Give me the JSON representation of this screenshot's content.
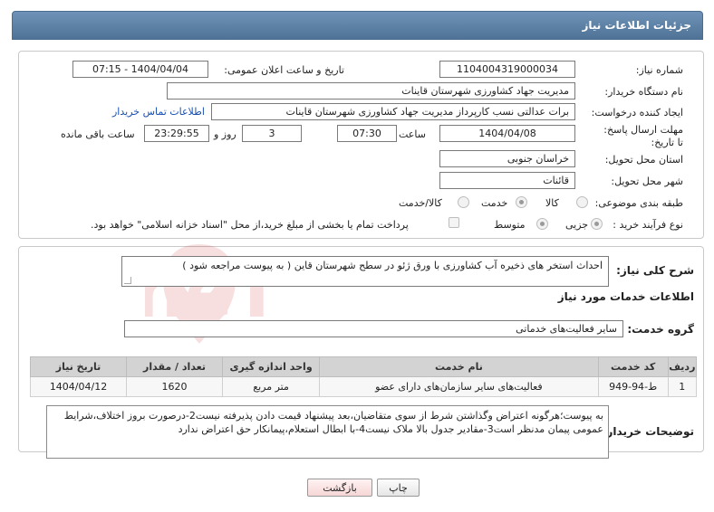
{
  "header": {
    "title": "جزئیات اطلاعات نیاز"
  },
  "form": {
    "need_number": {
      "label": "شماره نیاز:",
      "value": "1104004319000034"
    },
    "announce_datetime": {
      "label": "تاریخ و ساعت اعلان عمومی:",
      "value": "1404/04/04 - 07:15"
    },
    "buyer_org": {
      "label": "نام دستگاه خریدار:",
      "value": "مدیریت جهاد کشاورزی شهرستان قاینات"
    },
    "requester": {
      "label": "ایجاد کننده درخواست:",
      "value": "برات عدالتی نسب کارپرداز مدیریت جهاد کشاورزی شهرستان قاینات",
      "contact_link": "اطلاعات تماس خریدار"
    },
    "deadline": {
      "label": "مهلت ارسال پاسخ: تا تاریخ:",
      "date": "1404/04/08",
      "time_label": "ساعت",
      "time": "07:30",
      "days": "3",
      "days_label": "روز و",
      "remaining": "23:29:55",
      "remaining_label": "ساعت باقی مانده"
    },
    "province": {
      "label": "استان محل تحویل:",
      "value": "خراسان جنوبی"
    },
    "city": {
      "label": "شهر محل تحویل:",
      "value": "قائنات"
    },
    "category": {
      "label": "طبقه بندی موضوعی:",
      "options": [
        "کالا",
        "خدمت",
        "کالا/خدمت"
      ],
      "selected": "خدمت"
    },
    "purchase_type": {
      "label": "نوع فرآیند خرید :",
      "options": [
        "جزیی",
        "متوسط"
      ],
      "selected": "جزیی",
      "treasury_note": "پرداخت تمام یا بخشی از مبلغ خرید،از محل \"اسناد خزانه اسلامی\" خواهد بود."
    }
  },
  "need_summary": {
    "label": "شرح کلی نیاز:",
    "value": "احداث استخر های ذخیره آب کشاورزی با ورق ژئو در سطح شهرستان قاین ( به پیوست مراجعه شود )"
  },
  "services": {
    "section_title": "اطلاعات خدمات مورد نیاز",
    "group_label": "گروه خدمت:",
    "group_value": "سایر فعالیت‌های خدماتی",
    "columns": [
      "ردیف",
      "کد خدمت",
      "نام خدمت",
      "واحد اندازه گیری",
      "تعداد / مقدار",
      "تاریخ نیاز"
    ],
    "rows": [
      {
        "row": "1",
        "code": "ط-94-949",
        "name": "فعالیت‌های سایر سازمان‌های دارای عضو",
        "unit": "متر مربع",
        "qty": "1620",
        "date": "1404/04/12"
      }
    ]
  },
  "buyer_notes": {
    "label": "توضیحات خریدار:",
    "value": "به پیوست؛هرگونه اعتراض وگذاشتن شرط از سوی متقاضیان،بعد پیشنهاد قیمت دادن پذیرفته نیست2-درصورت بروز اختلاف،شرایط عمومی پیمان مدنظر است3-مقادیر جدول بالا ملاک نیست4-با ابطال استعلام،پیمانکار حق اعتراض ندارد"
  },
  "buttons": {
    "print": "چاپ",
    "back": "بازگشت"
  },
  "watermark": {
    "text": "AriaTender.neT"
  },
  "colors": {
    "header_bg": "#5a7ea3",
    "link": "#1a4fb0",
    "back_btn_bg": "#fbe3e3"
  }
}
